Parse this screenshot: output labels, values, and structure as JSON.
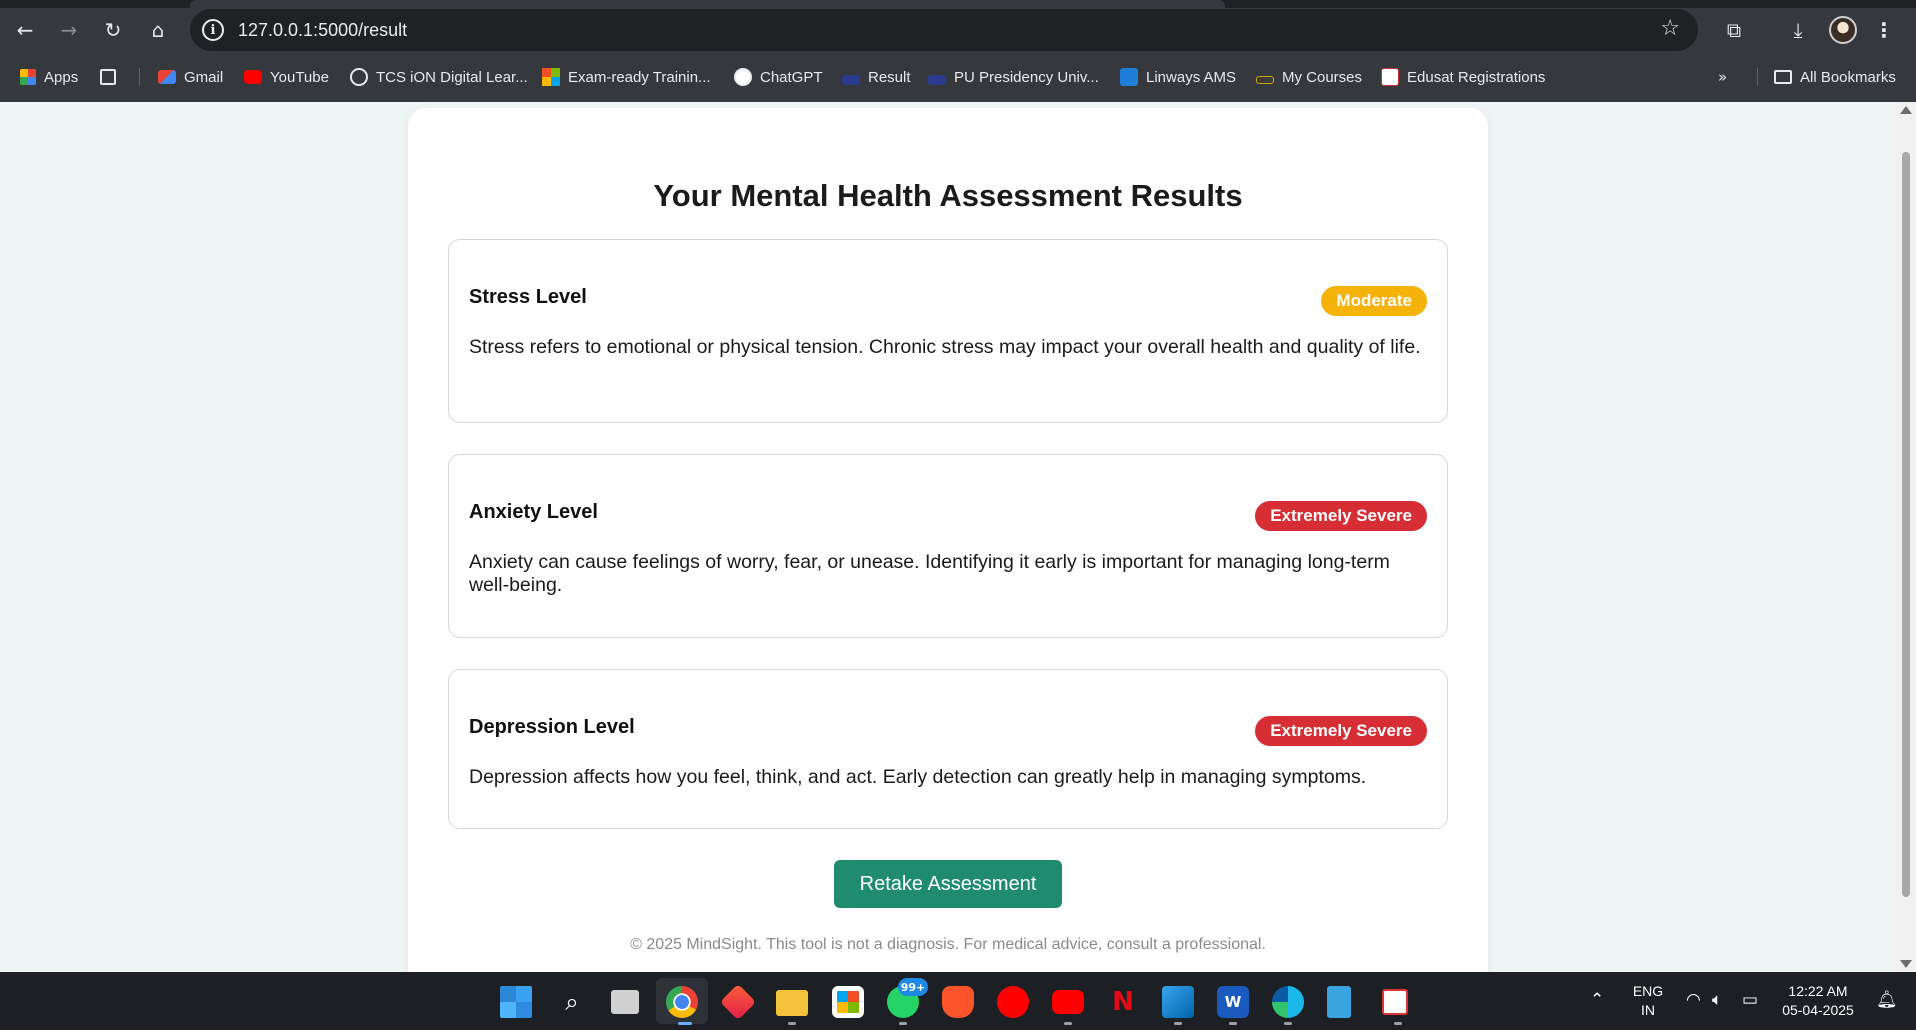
{
  "browser": {
    "url": "127.0.0.1:5000/result",
    "bookmarks": [
      {
        "label": "Apps",
        "icon": "apps-grid-icon"
      },
      {
        "label": "Gmail",
        "icon": "gmail-icon"
      },
      {
        "label": "YouTube",
        "icon": "youtube-icon"
      },
      {
        "label": "TCS iON Digital Lear...",
        "icon": "tcs-ion-icon"
      },
      {
        "label": "Exam-ready Trainin...",
        "icon": "microsoft-icon"
      },
      {
        "label": "ChatGPT",
        "icon": "chatgpt-icon"
      },
      {
        "label": "Result",
        "icon": "result-icon"
      },
      {
        "label": "PU Presidency Univ...",
        "icon": "presidency-icon"
      },
      {
        "label": "Linways AMS",
        "icon": "linways-icon"
      },
      {
        "label": "My Courses",
        "icon": "courses-icon"
      },
      {
        "label": "Edusat Registrations",
        "icon": "edusat-icon"
      }
    ],
    "all_bookmarks_label": "All Bookmarks"
  },
  "page": {
    "title": "Your Mental Health Assessment Results",
    "results": [
      {
        "name": "Stress Level",
        "severity": "Moderate",
        "severity_color": "#f5b30a",
        "description": "Stress refers to emotional or physical tension. Chronic stress may impact your overall health and quality of life."
      },
      {
        "name": "Anxiety Level",
        "severity": "Extremely Severe",
        "severity_color": "#d72e36",
        "description": "Anxiety can cause feelings of worry, fear, or unease. Identifying it early is important for managing long-term well-being."
      },
      {
        "name": "Depression Level",
        "severity": "Extremely Severe",
        "severity_color": "#d72e36",
        "description": "Depression affects how you feel, think, and act. Early detection can greatly help in managing symptoms."
      }
    ],
    "retake_label": "Retake Assessment",
    "retake_color": "#1f8b6f",
    "footer": "© 2025 MindSight. This tool is not a diagnosis. For medical advice, consult a professional."
  },
  "taskbar": {
    "notification_badge": "99+",
    "language": {
      "line1": "ENG",
      "line2": "IN"
    },
    "clock": {
      "time": "12:22 AM",
      "date": "05-04-2025"
    }
  }
}
